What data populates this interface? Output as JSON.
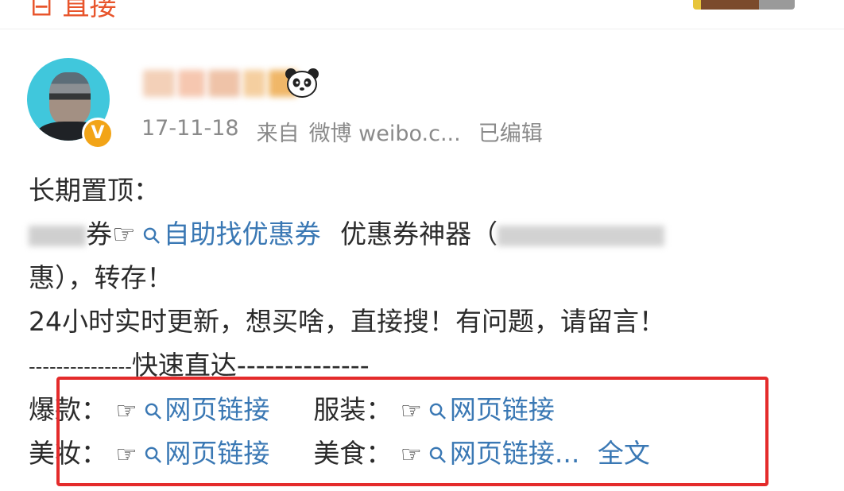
{
  "top_bar": {
    "link_label": "直接"
  },
  "post": {
    "meta": {
      "date": "17-11-18",
      "source_prefix": "来自",
      "source": "微博 weibo.c...",
      "edited": "已编辑"
    },
    "badge_label": "V",
    "body": {
      "line1": "长期置顶：",
      "line2_a": "券☞",
      "line2_link": "自助找优惠券",
      "line2_b": "优惠券神器（",
      "line3": "惠），转存！",
      "line4": "24小时实时更新，想买啥，直接搜！有问题，请留言！",
      "line5_dashes_left": "---------------",
      "line5_title": "快速直达",
      "line5_dashes_right": "--------------",
      "row1": {
        "label_a": "爆款：",
        "hand_a": "☞",
        "link_a": "网页链接",
        "label_b": "服装：",
        "hand_b": "☞",
        "link_b": "网页链接"
      },
      "row2": {
        "label_a": "美妆：",
        "hand_a": "☞",
        "link_a": "网页链接",
        "label_b": "美食：",
        "hand_b": "☞",
        "link_b": "网页链接...",
        "full_text": "全文"
      }
    }
  },
  "icons": {
    "link": "link-icon",
    "pointing_hand": "pointing-hand-icon",
    "panda": "panda-icon",
    "verified": "verified-badge-icon"
  },
  "colors": {
    "link": "#3a78b4",
    "highlight": "#e42b2b",
    "meta_text": "#8a8a8a",
    "top_accent": "#e8552c",
    "badge": "#f2a417"
  }
}
